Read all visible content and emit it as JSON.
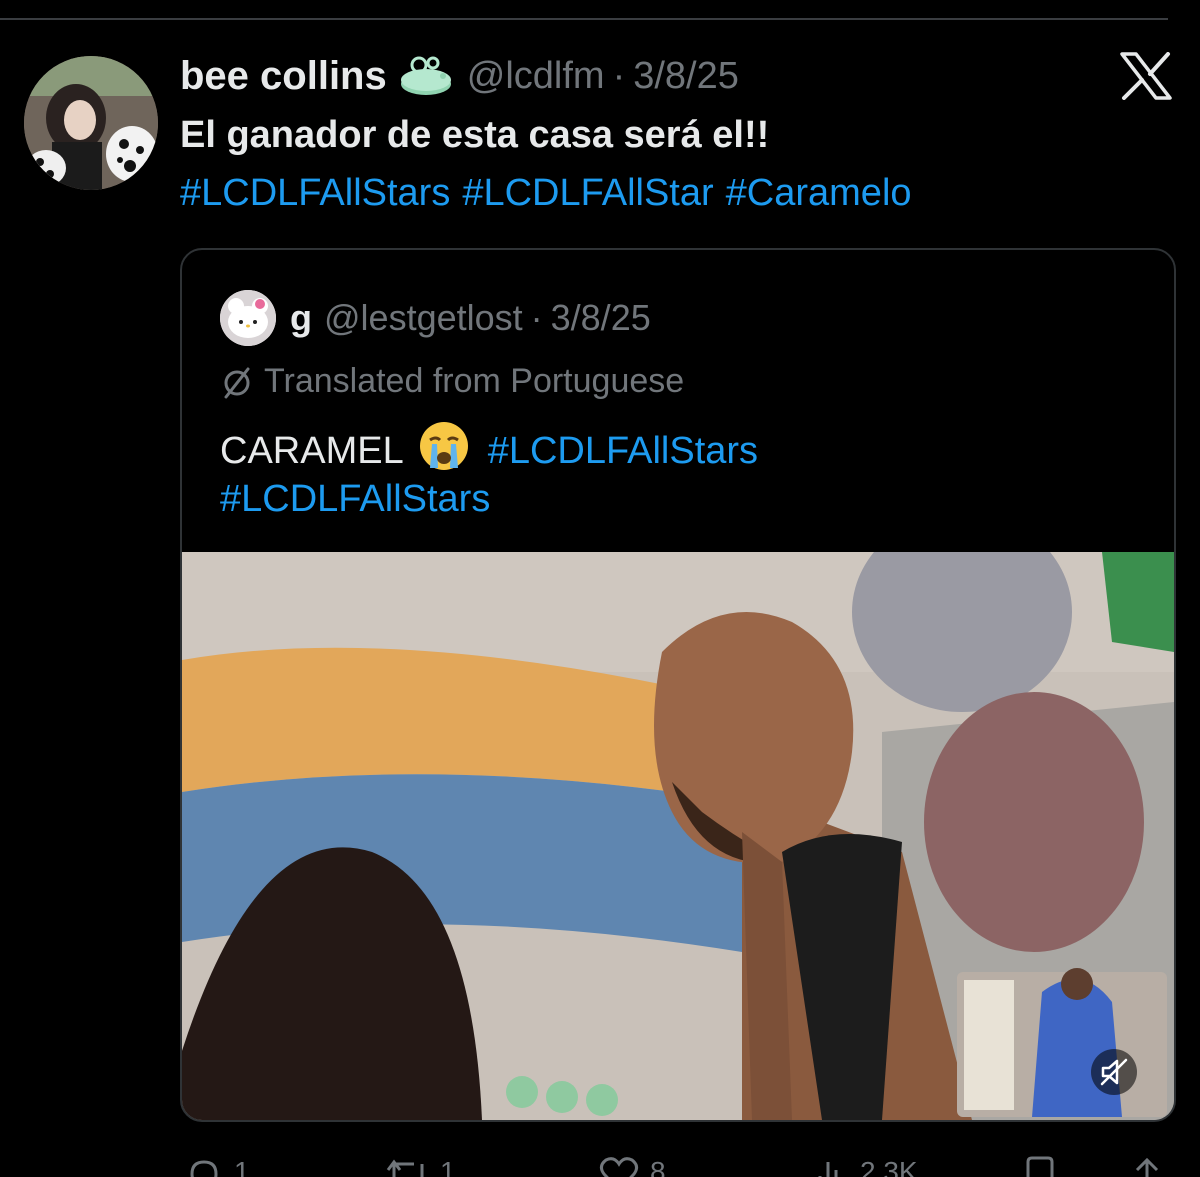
{
  "tweet": {
    "author_name": "bee collins",
    "handle": "@lcdlfm",
    "separator": "·",
    "date": "3/8/25",
    "text": "El ganador de esta casa será el!!",
    "hashtags": [
      "#LCDLFAllStars",
      "#LCDLFAllStar",
      "#Caramelo"
    ]
  },
  "quote": {
    "author_name": "g",
    "handle": "@lestgetlost",
    "separator": "·",
    "date": "3/8/25",
    "translated_label": "Translated from Portuguese",
    "text": "CARAMEL",
    "emoji": "😭",
    "hashtag_inline": "#LCDLFAllStars",
    "hashtag_line2": "#LCDLFAllStars"
  },
  "actions": {
    "replies": "1",
    "reposts": "1",
    "likes": "8",
    "views": "2.3K"
  },
  "icons": {
    "app_logo": "x-logo-icon",
    "mute": "muted-speaker-icon",
    "reply": "reply-bubble-icon",
    "repost": "repost-icon",
    "like": "heart-icon",
    "views": "views-bars-icon",
    "bookmark": "bookmark-icon",
    "share": "share-icon",
    "author_badge": "soap-emoji-icon",
    "translate": "globe-slash-icon"
  },
  "colors": {
    "background": "#000000",
    "text": "#e7e9ea",
    "muted": "#71767b",
    "link": "#1d9bf0",
    "border": "#2f3336"
  }
}
